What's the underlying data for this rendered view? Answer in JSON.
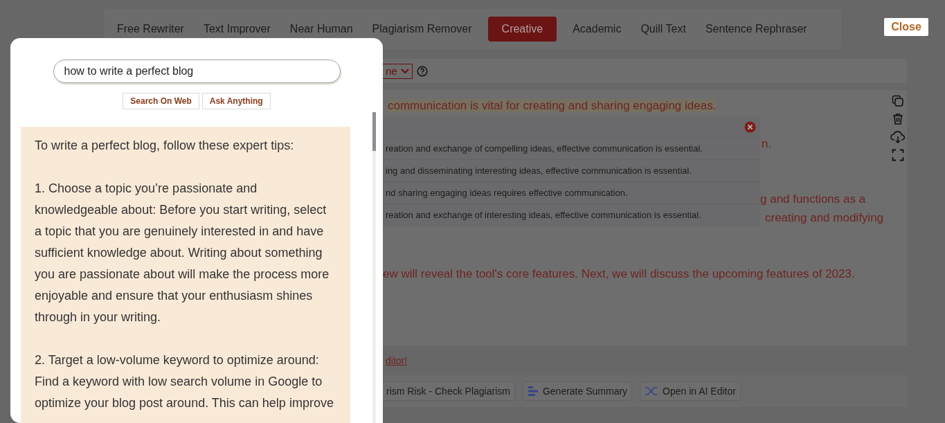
{
  "tabs": [
    {
      "label": "Free Rewriter",
      "selected": false
    },
    {
      "label": "Text Improver",
      "selected": false
    },
    {
      "label": "Near Human",
      "selected": false
    },
    {
      "label": "Plagiarism Remover",
      "selected": false
    },
    {
      "label": "Creative",
      "selected": true
    },
    {
      "label": "Academic",
      "selected": false
    },
    {
      "label": "Quill Text",
      "selected": false
    },
    {
      "label": "Sentence Rephraser",
      "selected": false
    }
  ],
  "close_button": "Close",
  "mode_select": {
    "value": "ne"
  },
  "editor": {
    "lines": [
      {
        "text": "communication is vital for creating and sharing engaging ideas.",
        "highlighted": true
      },
      {
        "text": "n.",
        "highlighted": false
      },
      {
        "text": "g and functions as a",
        "highlighted": false
      },
      {
        "text": "creating and modifying",
        "highlighted": false
      },
      {
        "text": "ew will reveal the tool's core features. Next, we will discuss the upcoming features of 2023.",
        "highlighted": false
      }
    ],
    "suggestions": [
      "reation and exchange of compelling ideas, effective communication is essential.",
      "ing and disseminating interesting ideas, effective communication is essential.",
      "nd sharing engaging ideas requires effective communication.",
      "reation and exchange of interesting ideas, effective communication is essential."
    ]
  },
  "editor_link": "ditor!",
  "action_buttons": [
    {
      "label": "rism Risk - Check Plagiarism",
      "kind": "plain"
    },
    {
      "label": "Generate Summary",
      "kind": "summary"
    },
    {
      "label": "Open in AI Editor",
      "kind": "editor"
    }
  ],
  "search_panel": {
    "query": "how to write a perfect blog",
    "buttons": [
      "Search On Web",
      "Ask Anything"
    ],
    "answer": [
      "To write a perfect blog, follow these expert tips:",
      "1. Choose a topic you’re passionate and knowledgeable about: Before you start writing, select a topic that you are genuinely interested in and have sufficient knowledge about. Writing about something you are passionate about will make the process more enjoyable and ensure that your enthusiasm shines through in your writing.",
      "2. Target a low-volume keyword to optimize around: Find a keyword with low search volume in Google to optimize your blog post around. This can help improve"
    ]
  }
}
